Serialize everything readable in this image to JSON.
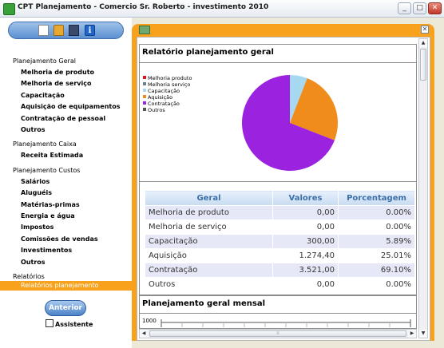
{
  "window": {
    "title": "CPT Planejamento - Comercio Sr. Roberto - investimento 2010",
    "minimize": "_",
    "maximize": "□",
    "close": "✕"
  },
  "toolbar": {
    "icons": [
      "new-file-icon",
      "open-folder-icon",
      "save-icon",
      "info-icon"
    ],
    "info_glyph": "i"
  },
  "sidebar": {
    "groups": [
      {
        "title": "Planejamento Geral",
        "items": [
          "Melhoria de produto",
          "Melhoria de serviço",
          "Capacitação",
          "Aquisição de equipamentos",
          "Contratação de pessoal",
          "Outros"
        ]
      },
      {
        "title": "Planejamento Caixa",
        "items": [
          "Receita Estimada"
        ]
      },
      {
        "title": "Planejamento Custos",
        "items": [
          "Salários",
          "Aluguéis",
          "Matérias-primas",
          "Energia e água",
          "Impostos",
          "Comissões de vendas",
          "Investimentos",
          "Outros"
        ]
      },
      {
        "title": "Relatórios",
        "items": [
          "Relatórios planejamento"
        ]
      }
    ],
    "selected_item": "Relatórios planejamento",
    "anterior_label": "Anterior",
    "assistente_label": "Assistente",
    "assistente_checked": false
  },
  "report": {
    "title": "Relatório planejamento geral",
    "legend": [
      {
        "label": "Melhoria produto",
        "color": "#e0141c"
      },
      {
        "label": "Melhoria serviço",
        "color": "#6f7e8c"
      },
      {
        "label": "Capacitação",
        "color": "#a6d8ef"
      },
      {
        "label": "Aquisição",
        "color": "#f08c1c"
      },
      {
        "label": "Contratação",
        "color": "#9b22de"
      },
      {
        "label": "Outros",
        "color": "#555555"
      }
    ],
    "table": {
      "headers": [
        "Geral",
        "Valores",
        "Porcentagem"
      ],
      "rows": [
        [
          "Melhoria de produto",
          "0,00",
          "0.00%"
        ],
        [
          "Melhoria de serviço",
          "0,00",
          "0.00%"
        ],
        [
          "Capacitação",
          "300,00",
          "5.89%"
        ],
        [
          "Aquisição",
          "1.274,40",
          "25.01%"
        ],
        [
          "Contratação",
          "3.521,00",
          "69.10%"
        ],
        [
          "Outros",
          "0,00",
          "0.00%"
        ]
      ]
    },
    "monthly_title": "Planejamento geral mensal",
    "monthly_y_top": "1000"
  },
  "chart_data": {
    "type": "pie",
    "categories": [
      "Melhoria produto",
      "Melhoria serviço",
      "Capacitação",
      "Aquisição",
      "Contratação",
      "Outros"
    ],
    "values": [
      0,
      0,
      300,
      1274.4,
      3521,
      0
    ],
    "percentages": [
      0,
      0,
      5.89,
      25.01,
      69.1,
      0
    ],
    "colors": [
      "#e0141c",
      "#6f7e8c",
      "#a6d8ef",
      "#f08c1c",
      "#9b22de",
      "#555555"
    ],
    "legend_position": "top-left",
    "title": ""
  }
}
